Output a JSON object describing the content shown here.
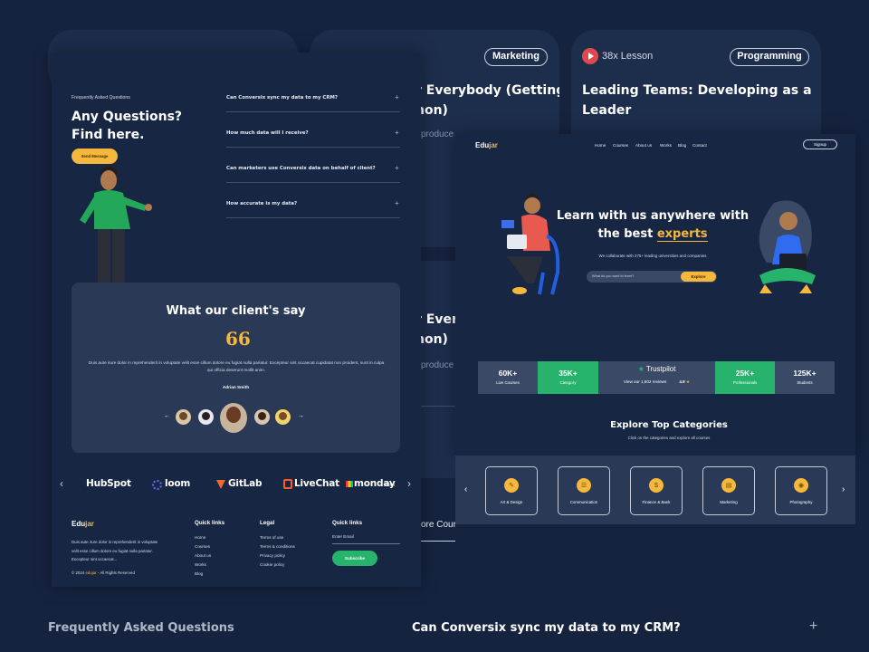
{
  "blog_cards": [
    {
      "tag": "",
      "title": ""
    },
    {
      "tag": "Marketing",
      "title": "r Everybody (Getting",
      "title2": "hon)",
      "excerpt": "produce",
      "excerpt2": ""
    },
    {
      "lesson": "38x Lesson",
      "tag": "Programming",
      "title": "Leading Teams: Developing as a",
      "title2": "Leader"
    }
  ],
  "lower_card": {
    "title": "r Ever",
    "title2": "hon)",
    "excerpt": "produce",
    "link": "ore Cour"
  },
  "faq": {
    "eyebrow": "Frequently Asked Questions",
    "heading1": "Any Questions?",
    "heading2": "Find here.",
    "button": "Send Message",
    "questions": [
      "Can Conversix sync my data to my CRM?",
      "How much data will I receive?",
      "Can marketers use Conversix data on behalf of client?",
      "How accurate is my data?"
    ],
    "plus": "+"
  },
  "testimonial": {
    "title": "What our client's say",
    "quote_mark": "66",
    "text": "Duis aute irure dolor in reprehenderit in voluptate velit esse cillum dolore eu fugiat nulla pariatur. Excepteur sint occaecat cupidatat non proident, sunt in culpa qui officia deserunt mollit anim.",
    "author": "Adrian Smith",
    "prev": "←",
    "next": "→"
  },
  "brands": {
    "prev": "‹",
    "next": "›",
    "items": [
      "HubSpot",
      "loom",
      "GitLab",
      "LiveChat",
      "monday"
    ],
    "monday_suffix": ".com"
  },
  "footer": {
    "brand_a": "Edu",
    "brand_b": "jar",
    "about": "Duis aute irure dolor in reprehenderit in voluptate velit esse cillum dolore eu fugiat nulla pariatur. Excepteur sint occaecat...",
    "copyright_a": "© 2024 ",
    "copyright_b": "edujar",
    "copyright_c": " - All Rights Reserved",
    "col1_title": "Quick links",
    "col1": [
      "Home",
      "Courses",
      "About us",
      "Works",
      "Blog"
    ],
    "col2_title": "Legal",
    "col2": [
      "Terms of use",
      "Terms & conditions",
      "Privacy policy",
      "Cookie policy"
    ],
    "col3_title": "Quick links",
    "email_placeholder": "Enter Email",
    "subscribe": "Subscribe"
  },
  "landing": {
    "brand_a": "Edu",
    "brand_b": "jar",
    "nav": [
      "Home",
      "Courses",
      "About us",
      "Works",
      "Blog",
      "Contact"
    ],
    "signup": "Signup",
    "hero1": "Learn with us anywhere with",
    "hero2a": "the best ",
    "hero2b": "experts",
    "sub": "We collaborate with 275+ leading universities and companies",
    "search_placeholder": "What do you want to learn?",
    "explore": "Explore",
    "stats": [
      {
        "n": "60K+",
        "l": "Live Courses"
      },
      {
        "n": "35K+",
        "l": "Category"
      },
      {
        "n": "25K+",
        "l": "Professionals"
      },
      {
        "n": "125K+",
        "l": "Students"
      }
    ],
    "trust_name": "Trustpilot",
    "trust_reviews": "View our 1,602 reviews",
    "trust_score": "4.9",
    "cat_title": "Explore Top Categories",
    "cat_sub": "Click on the categories and explore all courses",
    "categories": [
      "Art & Design",
      "Communication",
      "Finance & Bank",
      "Marketing",
      "Photography"
    ],
    "cat_prev": "‹",
    "cat_next": "›"
  },
  "bottom": {
    "left": "Frequently Asked Questions",
    "question": "Can Conversix sync my data to my CRM?",
    "plus": "+"
  },
  "colors": {
    "bg": "#16233f",
    "accent_yellow": "#f5b83d",
    "accent_green": "#27b36b",
    "stat_blue": "#3a4a66"
  }
}
